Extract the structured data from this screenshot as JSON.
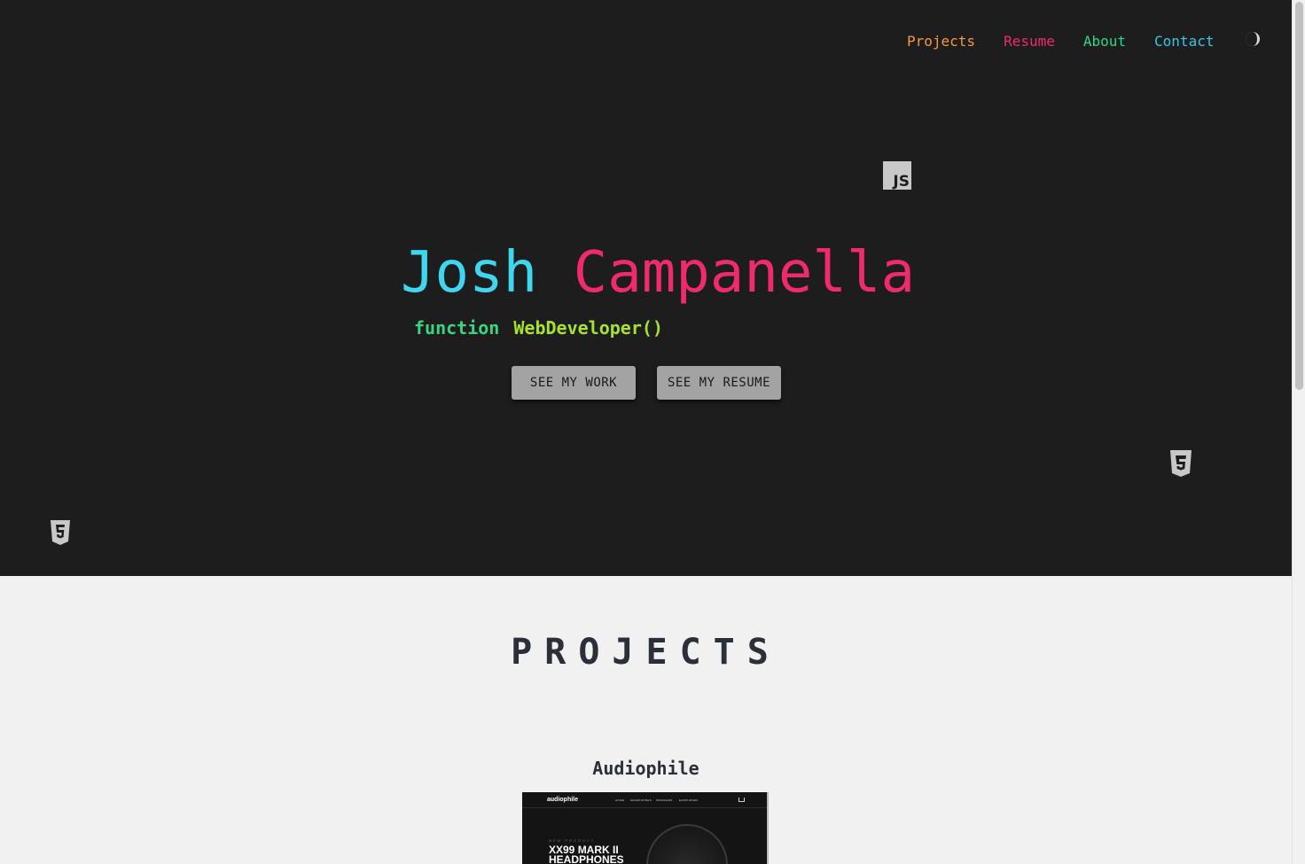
{
  "nav": {
    "items": [
      {
        "label": "Projects",
        "color": "#f59a3c"
      },
      {
        "label": "Resume",
        "color": "#ef2a6c"
      },
      {
        "label": "About",
        "color": "#2ad68a"
      },
      {
        "label": "Contact",
        "color": "#33c8e8"
      }
    ],
    "theme_toggle_icon": "half-moon-icon"
  },
  "hero": {
    "first_name": "Josh",
    "last_name": "Campanella",
    "first_name_color": "#3fd6f0",
    "last_name_color": "#f02a6e",
    "subtitle_keyword": "function",
    "subtitle_name": "WebDeveloper()",
    "subtitle_keyword_color": "#37d67f",
    "subtitle_name_color": "#a6e22e",
    "js_badge": "JS",
    "buttons": {
      "work": "SEE MY WORK",
      "resume": "SEE MY RESUME"
    },
    "floating_icons": [
      "js-icon",
      "css3-icon",
      "html5-icon"
    ]
  },
  "projects": {
    "title": "PROJECTS",
    "items": [
      {
        "name": "Audiophile",
        "preview": {
          "logo": "audiophile",
          "nav": [
            "HOME",
            "HEADPHONES",
            "SPEAKERS",
            "EARPHONES"
          ],
          "eyebrow": "NEW PRODUCT",
          "headline": "XX99 MARK II HEADPHONES"
        }
      }
    ]
  }
}
